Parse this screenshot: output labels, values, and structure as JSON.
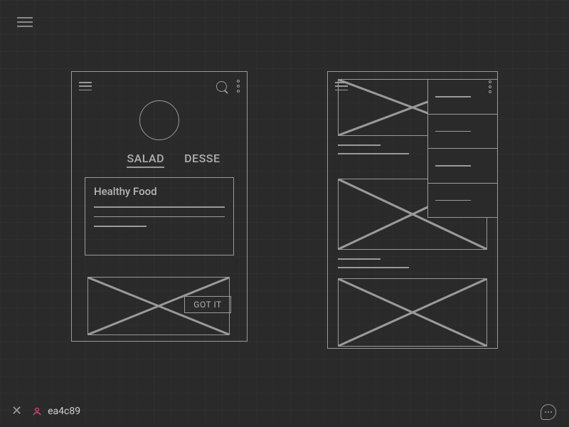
{
  "colors": {
    "bg": "#2a2a2a",
    "stroke": "#9a9a9a",
    "accent": "#ea4c89"
  },
  "topbar": {
    "menu_label": "menu"
  },
  "left_mockup": {
    "tabs": [
      "SALAD",
      "DESSE"
    ],
    "active_tab": 0,
    "card_title": "Healthy Food",
    "snackbar_button": "GOT IT"
  },
  "right_mockup": {
    "menu_open": true,
    "menu_items": [
      "",
      "",
      "",
      ""
    ]
  },
  "bottombar": {
    "user_color": "ea4c89"
  }
}
